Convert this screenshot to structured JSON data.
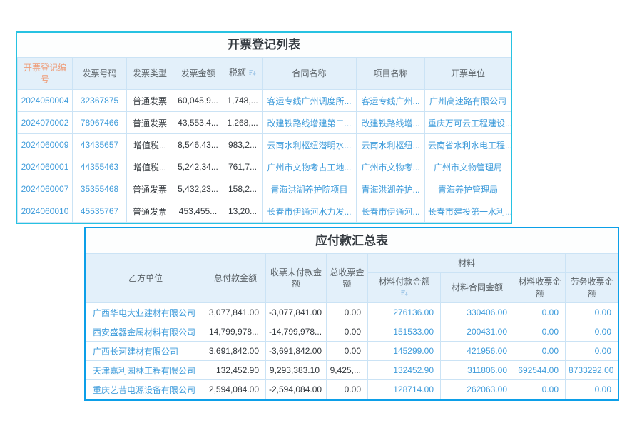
{
  "invoice_table": {
    "title": "开票登记列表",
    "columns": [
      "开票登记编号",
      "发票号码",
      "发票类型",
      "发票金额",
      "税额",
      "合同名称",
      "项目名称",
      "开票单位"
    ],
    "rows": [
      [
        "2024050004",
        "32367875",
        "普通发票",
        "60,045,9...",
        "1,748,...",
        "客运专线广州调度所...",
        "客运专线广州...",
        "广州高速路有限公司"
      ],
      [
        "2024070002",
        "78967466",
        "普通发票",
        "43,553,4...",
        "1,268,...",
        "改建铁路线增建第二...",
        "改建铁路线增...",
        "重庆万可云工程建设..."
      ],
      [
        "2024060009",
        "43435657",
        "增值税...",
        "8,546,43...",
        "983,2...",
        "云南水利枢纽潜明水...",
        "云南水利枢纽...",
        "云南省水利水电工程..."
      ],
      [
        "2024060001",
        "44355463",
        "增值税...",
        "5,242,34...",
        "761,7...",
        "广州市文物考古工地...",
        "广州市文物考...",
        "广州市文物管理局"
      ],
      [
        "2024060007",
        "35355468",
        "普通发票",
        "5,432,23...",
        "158,2...",
        "青海洪湖养护院项目",
        "青海洪湖养护...",
        "青海养护管理局"
      ],
      [
        "2024060010",
        "45535767",
        "普通发票",
        "453,455...",
        "13,20...",
        "长春市伊通河水力发...",
        "长春市伊通河...",
        "长春市建投第一水利..."
      ]
    ]
  },
  "payable_table": {
    "title": "应付款汇总表",
    "columns": {
      "party": "乙方单位",
      "total_paid": "总付款金额",
      "received_unpaid": "收票未付款金额",
      "total_received": "总收票金额",
      "material_group": "材料",
      "material_paid": "材料付款金额",
      "material_contract": "材料合同金额",
      "material_received": "材料收票金额",
      "labor_received": "劳务收票金额"
    },
    "rows": [
      [
        "广西华电大业建材有限公司",
        "3,077,841.00",
        "-3,077,841.00",
        "0.00",
        "276136.00",
        "330406.00",
        "0.00",
        "0.00"
      ],
      [
        "西安盛器金属材料有限公司",
        "14,799,978...",
        "-14,799,978...",
        "0.00",
        "151533.00",
        "200431.00",
        "0.00",
        "0.00"
      ],
      [
        "广西长河建材有限公司",
        "3,691,842.00",
        "-3,691,842.00",
        "0.00",
        "145299.00",
        "421956.00",
        "0.00",
        "0.00"
      ],
      [
        "天津嘉利园林工程有限公司",
        "132,452.90",
        "9,293,383.10",
        "9,425,...",
        "132452.90",
        "311806.00",
        "692544.00",
        "8733292.00"
      ],
      [
        "重庆艺昔电源设备有限公司",
        "2,594,084.00",
        "-2,594,084.00",
        "0.00",
        "128714.00",
        "262063.00",
        "0.00",
        "0.00"
      ]
    ]
  },
  "colors": {
    "invoice_border": "#27c2e2",
    "payable_border": "#0c9fe8",
    "header_bg": "#e3f0fa",
    "link_blue": "#3f9cdb",
    "header_orange": "#ee9c78"
  }
}
